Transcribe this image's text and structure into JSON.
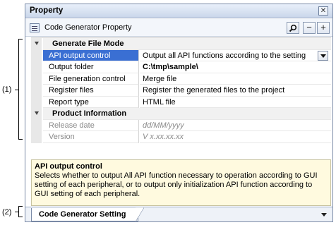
{
  "callouts": {
    "one": "(1)",
    "two": "(2)"
  },
  "window": {
    "title": "Property",
    "close_label": "✕"
  },
  "toolbar": {
    "object_name": "Code Generator Property",
    "search_label": "🔍",
    "collapse_label": "−",
    "expand_label": "+"
  },
  "grid": {
    "categories": [
      {
        "label": "Generate File Mode"
      },
      {
        "label": "Product Information"
      }
    ],
    "rows": [
      {
        "name": "API output control",
        "value": "Output all API functions according to the setting"
      },
      {
        "name": "Output folder",
        "value": "C:\\tmp\\sample\\"
      },
      {
        "name": "File generation control",
        "value": "Merge file"
      },
      {
        "name": "Register files",
        "value": "Register the generated files to the project"
      },
      {
        "name": "Report type",
        "value": "HTML file"
      },
      {
        "name": "Release date",
        "value": "dd/MM/yyyy"
      },
      {
        "name": "Version",
        "value": "V x.xx.xx.xx"
      }
    ]
  },
  "description": {
    "title": "API output control",
    "text": "Selects whether to output All API function necessary to operation according to GUI setting of each peripheral, or to output only initialization API function according to GUI setting of each peripheral."
  },
  "tabs": [
    {
      "label": "Code Generator Setting"
    }
  ]
}
